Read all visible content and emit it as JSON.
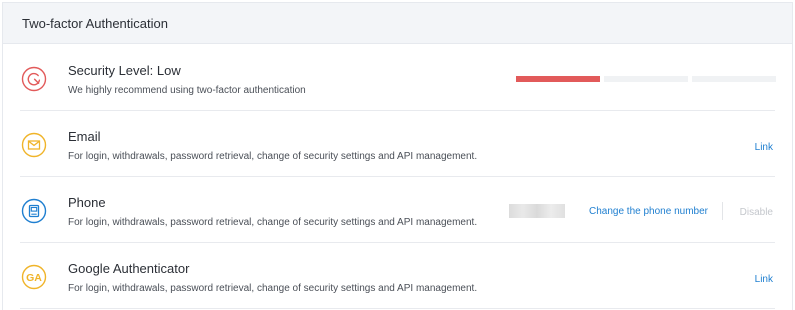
{
  "header": {
    "title": "Two-factor Authentication"
  },
  "security": {
    "title": "Security Level: Low",
    "description": "We highly recommend using two-factor authentication",
    "icon": "security-level-icon",
    "level_segments": 3,
    "level_active": 1,
    "accent_color": "#e25a5a"
  },
  "methods": [
    {
      "id": "email",
      "title": "Email",
      "description": "For login, withdrawals, password retrieval, change of security settings and API management.",
      "icon": "envelope-icon",
      "icon_color": "#f0b429",
      "action_label": "Link"
    },
    {
      "id": "phone",
      "title": "Phone",
      "description": "For login, withdrawals, password retrieval, change of security settings and API management.",
      "icon": "phone-icon",
      "icon_color": "#1f7fd0",
      "change_label": "Change the phone number",
      "disable_label": "Disable"
    },
    {
      "id": "google",
      "title": "Google Authenticator",
      "description": "For login, withdrawals, password retrieval, change of security settings and API management.",
      "icon": "google-authenticator-icon",
      "icon_color": "#f0b429",
      "icon_text": "GA",
      "action_label": "Link"
    }
  ],
  "colors": {
    "link": "#1f7fd0",
    "header_bg": "#f3f5f8",
    "disabled": "#c4c7cc"
  }
}
